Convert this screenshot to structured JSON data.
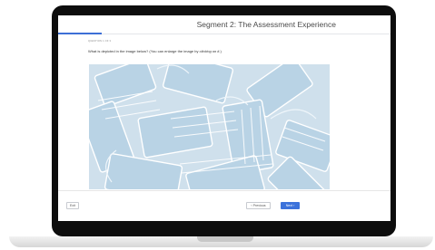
{
  "header": {
    "segment_title": "Segment 2: The Assessment Experience",
    "progress_fraction": 0.13
  },
  "question": {
    "counter": "QUESTION 1 OF 3",
    "prompt_start": "What is depicted in the image below? (You can enlarge the image by ",
    "prompt_emphasis": "clicking on it.",
    "prompt_end": ")"
  },
  "footer": {
    "exit_label": "Exit",
    "previous_label": "‹ Previous",
    "next_label": "Next ›"
  },
  "colors": {
    "accent": "#3c72db",
    "bezel": "#0d0d0d",
    "mask_blue": "#b7d3e6"
  }
}
